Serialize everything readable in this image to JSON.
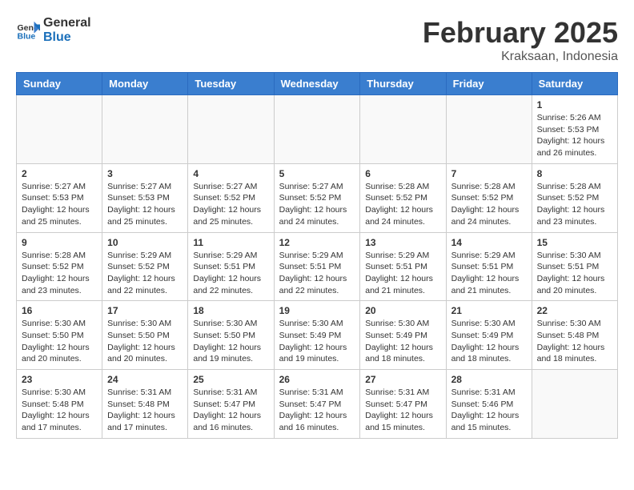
{
  "header": {
    "logo": {
      "general": "General",
      "blue": "Blue"
    },
    "month_year": "February 2025",
    "location": "Kraksaan, Indonesia"
  },
  "weekdays": [
    "Sunday",
    "Monday",
    "Tuesday",
    "Wednesday",
    "Thursday",
    "Friday",
    "Saturday"
  ],
  "weeks": [
    [
      {
        "day": "",
        "info": ""
      },
      {
        "day": "",
        "info": ""
      },
      {
        "day": "",
        "info": ""
      },
      {
        "day": "",
        "info": ""
      },
      {
        "day": "",
        "info": ""
      },
      {
        "day": "",
        "info": ""
      },
      {
        "day": "1",
        "info": "Sunrise: 5:26 AM\nSunset: 5:53 PM\nDaylight: 12 hours and 26 minutes."
      }
    ],
    [
      {
        "day": "2",
        "info": "Sunrise: 5:27 AM\nSunset: 5:53 PM\nDaylight: 12 hours and 25 minutes."
      },
      {
        "day": "3",
        "info": "Sunrise: 5:27 AM\nSunset: 5:53 PM\nDaylight: 12 hours and 25 minutes."
      },
      {
        "day": "4",
        "info": "Sunrise: 5:27 AM\nSunset: 5:52 PM\nDaylight: 12 hours and 25 minutes."
      },
      {
        "day": "5",
        "info": "Sunrise: 5:27 AM\nSunset: 5:52 PM\nDaylight: 12 hours and 24 minutes."
      },
      {
        "day": "6",
        "info": "Sunrise: 5:28 AM\nSunset: 5:52 PM\nDaylight: 12 hours and 24 minutes."
      },
      {
        "day": "7",
        "info": "Sunrise: 5:28 AM\nSunset: 5:52 PM\nDaylight: 12 hours and 24 minutes."
      },
      {
        "day": "8",
        "info": "Sunrise: 5:28 AM\nSunset: 5:52 PM\nDaylight: 12 hours and 23 minutes."
      }
    ],
    [
      {
        "day": "9",
        "info": "Sunrise: 5:28 AM\nSunset: 5:52 PM\nDaylight: 12 hours and 23 minutes."
      },
      {
        "day": "10",
        "info": "Sunrise: 5:29 AM\nSunset: 5:52 PM\nDaylight: 12 hours and 22 minutes."
      },
      {
        "day": "11",
        "info": "Sunrise: 5:29 AM\nSunset: 5:51 PM\nDaylight: 12 hours and 22 minutes."
      },
      {
        "day": "12",
        "info": "Sunrise: 5:29 AM\nSunset: 5:51 PM\nDaylight: 12 hours and 22 minutes."
      },
      {
        "day": "13",
        "info": "Sunrise: 5:29 AM\nSunset: 5:51 PM\nDaylight: 12 hours and 21 minutes."
      },
      {
        "day": "14",
        "info": "Sunrise: 5:29 AM\nSunset: 5:51 PM\nDaylight: 12 hours and 21 minutes."
      },
      {
        "day": "15",
        "info": "Sunrise: 5:30 AM\nSunset: 5:51 PM\nDaylight: 12 hours and 20 minutes."
      }
    ],
    [
      {
        "day": "16",
        "info": "Sunrise: 5:30 AM\nSunset: 5:50 PM\nDaylight: 12 hours and 20 minutes."
      },
      {
        "day": "17",
        "info": "Sunrise: 5:30 AM\nSunset: 5:50 PM\nDaylight: 12 hours and 20 minutes."
      },
      {
        "day": "18",
        "info": "Sunrise: 5:30 AM\nSunset: 5:50 PM\nDaylight: 12 hours and 19 minutes."
      },
      {
        "day": "19",
        "info": "Sunrise: 5:30 AM\nSunset: 5:49 PM\nDaylight: 12 hours and 19 minutes."
      },
      {
        "day": "20",
        "info": "Sunrise: 5:30 AM\nSunset: 5:49 PM\nDaylight: 12 hours and 18 minutes."
      },
      {
        "day": "21",
        "info": "Sunrise: 5:30 AM\nSunset: 5:49 PM\nDaylight: 12 hours and 18 minutes."
      },
      {
        "day": "22",
        "info": "Sunrise: 5:30 AM\nSunset: 5:48 PM\nDaylight: 12 hours and 18 minutes."
      }
    ],
    [
      {
        "day": "23",
        "info": "Sunrise: 5:30 AM\nSunset: 5:48 PM\nDaylight: 12 hours and 17 minutes."
      },
      {
        "day": "24",
        "info": "Sunrise: 5:31 AM\nSunset: 5:48 PM\nDaylight: 12 hours and 17 minutes."
      },
      {
        "day": "25",
        "info": "Sunrise: 5:31 AM\nSunset: 5:47 PM\nDaylight: 12 hours and 16 minutes."
      },
      {
        "day": "26",
        "info": "Sunrise: 5:31 AM\nSunset: 5:47 PM\nDaylight: 12 hours and 16 minutes."
      },
      {
        "day": "27",
        "info": "Sunrise: 5:31 AM\nSunset: 5:47 PM\nDaylight: 12 hours and 15 minutes."
      },
      {
        "day": "28",
        "info": "Sunrise: 5:31 AM\nSunset: 5:46 PM\nDaylight: 12 hours and 15 minutes."
      },
      {
        "day": "",
        "info": ""
      }
    ]
  ]
}
